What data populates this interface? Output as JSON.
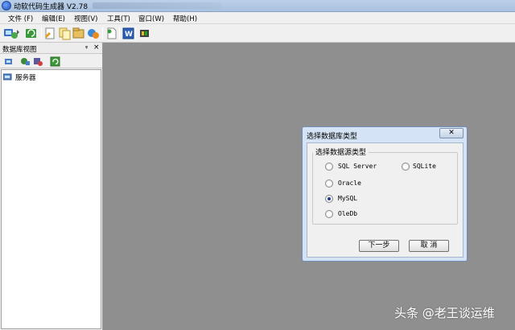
{
  "window": {
    "title": "动软代码生成器  V2.78"
  },
  "menu": [
    {
      "label": "文件 (F)"
    },
    {
      "label": "编辑(E)"
    },
    {
      "label": "视图(V)"
    },
    {
      "label": "工具(T)"
    },
    {
      "label": "窗口(W)"
    },
    {
      "label": "帮助(H)"
    }
  ],
  "toolbar": {
    "icons": [
      "server-connect-icon",
      "refresh-icon",
      "code-generator-icon",
      "copy-icon",
      "template-icon",
      "database-icon",
      "page-icon",
      "word-icon",
      "plugin-icon"
    ]
  },
  "panel": {
    "title": "数据库视图",
    "pin_glyph": "ᵠ",
    "close_glyph": "×",
    "tree": [
      {
        "label": "服务器"
      }
    ]
  },
  "dialog": {
    "title": "选择数据库类型",
    "close_glyph": "✕",
    "group_label": "选择数据源类型",
    "options": [
      {
        "label": "SQL Server",
        "checked": false
      },
      {
        "label": "SQLite",
        "checked": false
      },
      {
        "label": "Oracle",
        "checked": false
      },
      {
        "label": "MySQL",
        "checked": true
      },
      {
        "label": "OleDb",
        "checked": false
      }
    ],
    "next_label": "下一步",
    "cancel_label": "取 消"
  },
  "watermark": {
    "text": "头条 @老王谈运维"
  },
  "colors": {
    "workspace": "#8f8f8f",
    "dialog_frame": "#d4e3f5",
    "titlebar": "#bcd0e8"
  }
}
